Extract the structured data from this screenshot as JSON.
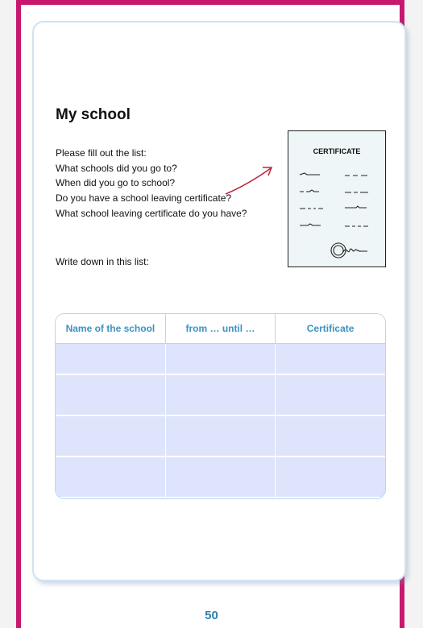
{
  "title": "My school",
  "instructions": [
    "Please fill out the list:",
    "What schools did you go to?",
    "When did you go to school?",
    "Do you have a school leaving certificate?",
    "What school leaving certificate do you have?"
  ],
  "write_prompt": "Write down in this list:",
  "certificate": {
    "label": "CERTIFICATE"
  },
  "table": {
    "headers": [
      "Name of the school",
      "from … until …",
      "Certificate"
    ],
    "rows": [
      [
        "",
        "",
        ""
      ],
      [
        "",
        "",
        ""
      ],
      [
        "",
        "",
        ""
      ],
      [
        "",
        "",
        ""
      ]
    ]
  },
  "page_number": "50",
  "colors": {
    "frame": "#c8186e",
    "header_text": "#3a92c4",
    "cell_fill": "#dde4fb",
    "page_number": "#2f7fb2"
  }
}
